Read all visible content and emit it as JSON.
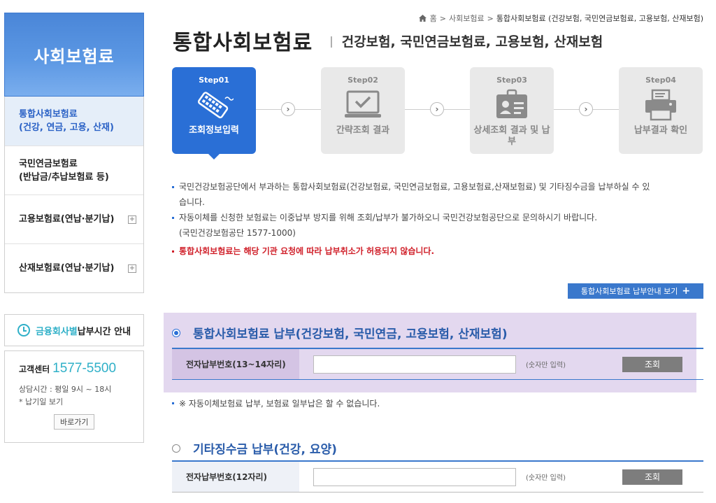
{
  "sidebar": {
    "header": "사회보험료",
    "items": [
      {
        "line1": "통합사회보험료",
        "line2": "(건강, 연금, 고용, 산재)",
        "plus": ""
      },
      {
        "line1": "국민연금보험료",
        "line2": "(반납금/추납보험료 등)",
        "plus": ""
      },
      {
        "line1": "고용보험료(연납·분기납)",
        "line2": "",
        "plus": "+"
      },
      {
        "line1": "산재보험료(연납·분기납)",
        "line2": "",
        "plus": "+"
      }
    ],
    "time_notice": {
      "highlight": "금융회사별",
      "rest": " 납부시간 안내"
    },
    "center": {
      "label": "고객센터",
      "phone": "1577-5500",
      "hours": "상담시간 : 평일 9시 ~ 18시",
      "holiday": "* 납기일 보기",
      "go_button": "바로가기"
    }
  },
  "breadcrumb": {
    "home": "홈",
    "sep1": ">",
    "level1": "사회보험료",
    "sep2": ">",
    "current": "통합사회보험료 (건강보험, 국민연금보험료, 고용보험, 산재보험)"
  },
  "title": {
    "main": "통합사회보험료",
    "separator": "|",
    "sub": "건강보험, 국민연금보험료, 고용보험, 산재보험"
  },
  "steps": [
    {
      "no": "Step01",
      "label": "조회정보입력",
      "active": true
    },
    {
      "no": "Step02",
      "label": "간략조회 결과",
      "active": false
    },
    {
      "no": "Step03",
      "label": "상세조회 결과 및 납부",
      "active": false
    },
    {
      "no": "Step04",
      "label": "납부결과 확인",
      "active": false
    }
  ],
  "step_arrow": "›",
  "notices": {
    "n1": "국민건강보험공단에서 부과하는 통합사회보험료(건강보험료, 국민연금보험료, 고용보험료,산재보험료) 및 기타징수금을 납부하실 수 있",
    "n1b": "습니다.",
    "n2": "자동이체를 신청한 보험료는 이중납부 방지를 위해 조회/납부가 불가하오니 국민건강보험공단으로 문의하시기 바랍니다.",
    "n2b": "(국민건강보험공단 1577-1000)",
    "n3": "통합사회보험료는 해당 기관 요청에 따라 납부취소가 허용되지 않습니다."
  },
  "guide_button": {
    "label": "통합사회보험료 납부안내 보기",
    "plus": "+"
  },
  "section1": {
    "title": "통합사회보험료 납부(건강보험, 국민연금, 고용보험, 산재보험)",
    "field_label": "전자납부번호(13~14자리)",
    "hint": "(숫자만 입력)",
    "button": "조회"
  },
  "note2": "※ 자동이체보험료 납부, 보험료 일부납은 할 수 없습니다.",
  "section2": {
    "title": "기타징수금 납부(건강, 요양)",
    "field_label": "전자납부번호(12자리)",
    "hint": "(숫자만 입력)",
    "button": "조회"
  },
  "colors": {
    "primary": "#2a6fd6",
    "accent": "#2fb0c8",
    "highlight_bg": "#e3d8ef",
    "warning": "#d0202a"
  }
}
